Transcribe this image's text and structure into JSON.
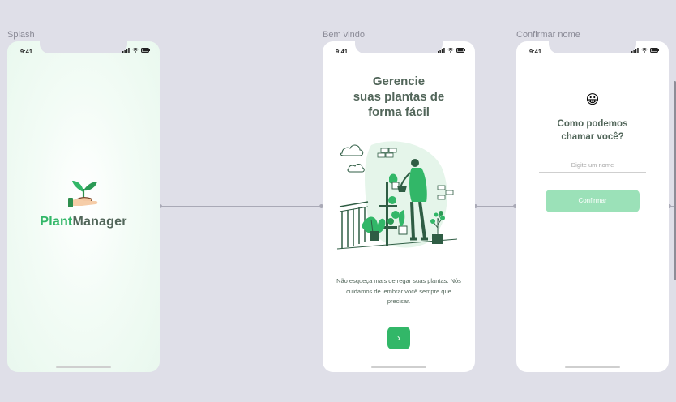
{
  "frames": {
    "splash": {
      "label": "Splash"
    },
    "welcome": {
      "label": "Bem vindo"
    },
    "confirm": {
      "label": "Confirmar nome"
    }
  },
  "status_bar": {
    "time": "9:41",
    "icons": [
      "signal-icon",
      "wifi-icon",
      "battery-icon"
    ]
  },
  "splash": {
    "logo_part1": "Plant",
    "logo_part2": "Manager",
    "logo_icon": "hand-with-plant-icon"
  },
  "welcome": {
    "title": "Gerencie\nsuas plantas de\nforma fácil",
    "illustration": "woman-watering-plants-illustration",
    "description": "Não esqueça mais de regar suas plantas. Nós cuidamos de lembrar você sempre que precisar.",
    "next_icon": "chevron-right-icon",
    "next_symbol": "›"
  },
  "confirm_name": {
    "emoji": "😀",
    "title": "Como podemos\nchamar você?",
    "input_value": "",
    "input_placeholder": "Digite um nome",
    "button_label": "Confirmar"
  },
  "colors": {
    "canvas": "#dfdfe8",
    "green": "#32b768",
    "green_light": "#9be1b8",
    "heading": "#52665a"
  }
}
